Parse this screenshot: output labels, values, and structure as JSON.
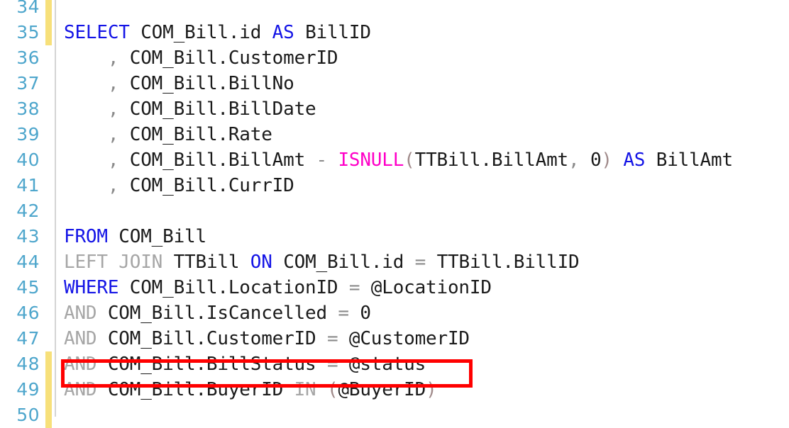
{
  "editor": {
    "language": "SQL",
    "background_color": "#ffffff",
    "line_number_color": "#4ea6cc",
    "change_marker_color": "#f7e07a",
    "gutter_rule_color": "#d4d4d4",
    "keyword_color": "#1414e6",
    "secondary_keyword_color": "#a6a6a6",
    "function_color": "#ff00c8",
    "identifier_color": "#1b1b1b",
    "operator_color": "#8a8a8a",
    "annotation_color": "#ff0000",
    "first_visible_line": 34,
    "last_visible_line": 50
  },
  "annotation": {
    "type": "rectangle-highlight",
    "target_line": 49,
    "color": "#ff0000"
  },
  "lines": [
    {
      "number": "34",
      "changed": true,
      "partial": true,
      "tokens": []
    },
    {
      "number": "35",
      "changed": true,
      "tokens": [
        {
          "t": "SELECT",
          "c": "kw"
        },
        {
          "t": " ",
          "c": "id"
        },
        {
          "t": "COM_Bill.id",
          "c": "id"
        },
        {
          "t": " ",
          "c": "id"
        },
        {
          "t": "AS",
          "c": "kw"
        },
        {
          "t": " ",
          "c": "id"
        },
        {
          "t": "BillID",
          "c": "id"
        }
      ]
    },
    {
      "number": "36",
      "changed": false,
      "tokens": [
        {
          "t": "    ",
          "c": "id"
        },
        {
          "t": ",",
          "c": "op"
        },
        {
          "t": " ",
          "c": "id"
        },
        {
          "t": "COM_Bill.CustomerID",
          "c": "id"
        }
      ]
    },
    {
      "number": "37",
      "changed": false,
      "tokens": [
        {
          "t": "    ",
          "c": "id"
        },
        {
          "t": ",",
          "c": "op"
        },
        {
          "t": " ",
          "c": "id"
        },
        {
          "t": "COM_Bill.BillNo",
          "c": "id"
        }
      ]
    },
    {
      "number": "38",
      "changed": false,
      "tokens": [
        {
          "t": "    ",
          "c": "id"
        },
        {
          "t": ",",
          "c": "op"
        },
        {
          "t": " ",
          "c": "id"
        },
        {
          "t": "COM_Bill.BillDate",
          "c": "id"
        }
      ]
    },
    {
      "number": "39",
      "changed": false,
      "tokens": [
        {
          "t": "    ",
          "c": "id"
        },
        {
          "t": ",",
          "c": "op"
        },
        {
          "t": " ",
          "c": "id"
        },
        {
          "t": "COM_Bill.Rate",
          "c": "id"
        }
      ]
    },
    {
      "number": "40",
      "changed": false,
      "tokens": [
        {
          "t": "    ",
          "c": "id"
        },
        {
          "t": ",",
          "c": "op"
        },
        {
          "t": " ",
          "c": "id"
        },
        {
          "t": "COM_Bill.BillAmt",
          "c": "id"
        },
        {
          "t": " ",
          "c": "id"
        },
        {
          "t": "-",
          "c": "op"
        },
        {
          "t": " ",
          "c": "id"
        },
        {
          "t": "ISNULL",
          "c": "fn"
        },
        {
          "t": "(",
          "c": "par"
        },
        {
          "t": "TTBill.BillAmt",
          "c": "id"
        },
        {
          "t": ",",
          "c": "op"
        },
        {
          "t": " ",
          "c": "id"
        },
        {
          "t": "0",
          "c": "num"
        },
        {
          "t": ")",
          "c": "par"
        },
        {
          "t": " ",
          "c": "id"
        },
        {
          "t": "AS",
          "c": "kw"
        },
        {
          "t": " ",
          "c": "id"
        },
        {
          "t": "BillAmt",
          "c": "id"
        }
      ]
    },
    {
      "number": "41",
      "changed": false,
      "tokens": [
        {
          "t": "    ",
          "c": "id"
        },
        {
          "t": ",",
          "c": "op"
        },
        {
          "t": " ",
          "c": "id"
        },
        {
          "t": "COM_Bill.CurrID",
          "c": "id"
        }
      ]
    },
    {
      "number": "42",
      "changed": false,
      "tokens": []
    },
    {
      "number": "43",
      "changed": false,
      "tokens": [
        {
          "t": "FROM",
          "c": "kw"
        },
        {
          "t": " ",
          "c": "id"
        },
        {
          "t": "COM_Bill",
          "c": "id"
        }
      ]
    },
    {
      "number": "44",
      "changed": false,
      "tokens": [
        {
          "t": "LEFT",
          "c": "kwg"
        },
        {
          "t": " ",
          "c": "id"
        },
        {
          "t": "JOIN",
          "c": "kwg"
        },
        {
          "t": " ",
          "c": "id"
        },
        {
          "t": "TTBill",
          "c": "id"
        },
        {
          "t": " ",
          "c": "id"
        },
        {
          "t": "ON",
          "c": "kw"
        },
        {
          "t": " ",
          "c": "id"
        },
        {
          "t": "COM_Bill.id",
          "c": "id"
        },
        {
          "t": " ",
          "c": "id"
        },
        {
          "t": "=",
          "c": "op"
        },
        {
          "t": " ",
          "c": "id"
        },
        {
          "t": "TTBill.BillID",
          "c": "id"
        }
      ]
    },
    {
      "number": "45",
      "changed": false,
      "tokens": [
        {
          "t": "WHERE",
          "c": "kw"
        },
        {
          "t": " ",
          "c": "id"
        },
        {
          "t": "COM_Bill.LocationID",
          "c": "id"
        },
        {
          "t": " ",
          "c": "id"
        },
        {
          "t": "=",
          "c": "op"
        },
        {
          "t": " ",
          "c": "id"
        },
        {
          "t": "@LocationID",
          "c": "id"
        }
      ]
    },
    {
      "number": "46",
      "changed": false,
      "tokens": [
        {
          "t": "AND",
          "c": "kwg"
        },
        {
          "t": " ",
          "c": "id"
        },
        {
          "t": "COM_Bill.IsCancelled",
          "c": "id"
        },
        {
          "t": " ",
          "c": "id"
        },
        {
          "t": "=",
          "c": "op"
        },
        {
          "t": " ",
          "c": "id"
        },
        {
          "t": "0",
          "c": "num"
        }
      ]
    },
    {
      "number": "47",
      "changed": false,
      "tokens": [
        {
          "t": "AND",
          "c": "kwg"
        },
        {
          "t": " ",
          "c": "id"
        },
        {
          "t": "COM_Bill.CustomerID",
          "c": "id"
        },
        {
          "t": " ",
          "c": "id"
        },
        {
          "t": "=",
          "c": "op"
        },
        {
          "t": " ",
          "c": "id"
        },
        {
          "t": "@CustomerID",
          "c": "id"
        }
      ]
    },
    {
      "number": "48",
      "changed": true,
      "tokens": [
        {
          "t": "AND",
          "c": "kwg"
        },
        {
          "t": " ",
          "c": "id"
        },
        {
          "t": "COM_Bill.BillStatus",
          "c": "id"
        },
        {
          "t": " ",
          "c": "id"
        },
        {
          "t": "=",
          "c": "op"
        },
        {
          "t": " ",
          "c": "id"
        },
        {
          "t": "@status",
          "c": "id"
        }
      ]
    },
    {
      "number": "49",
      "changed": true,
      "highlighted": true,
      "tokens": [
        {
          "t": "AND",
          "c": "kwg"
        },
        {
          "t": " ",
          "c": "id"
        },
        {
          "t": "COM_Bill.BuyerID",
          "c": "id"
        },
        {
          "t": " ",
          "c": "id"
        },
        {
          "t": "IN",
          "c": "kwg"
        },
        {
          "t": " ",
          "c": "id"
        },
        {
          "t": "(",
          "c": "par"
        },
        {
          "t": "@BuyerID",
          "c": "id"
        },
        {
          "t": ")",
          "c": "par"
        }
      ]
    },
    {
      "number": "50",
      "changed": true,
      "tokens": []
    }
  ]
}
